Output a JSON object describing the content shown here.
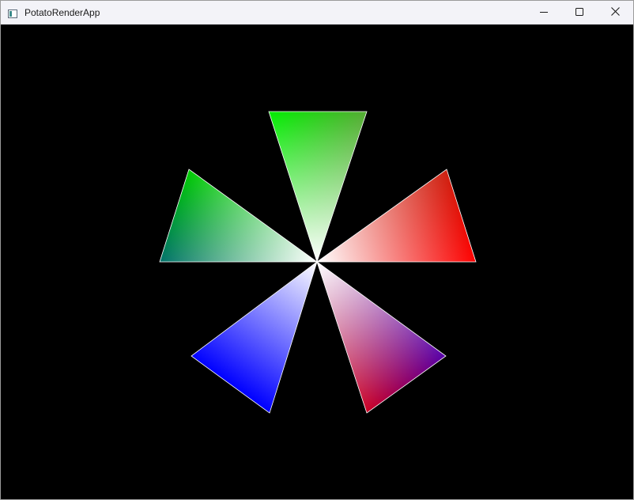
{
  "window": {
    "title": "PotatoRenderApp",
    "icons": {
      "app": "app-window-icon",
      "minimize": "minimize-icon",
      "maximize": "maximize-icon",
      "close": "close-icon"
    }
  },
  "canvas": {
    "background": "#000000",
    "outline_color": "#ffffff",
    "center_color": "#ffffff",
    "triangles": [
      {
        "name": "triangle-top",
        "outer_colors": [
          "#00ee00",
          "#55aa33"
        ]
      },
      {
        "name": "triangle-upper-left",
        "outer_colors": [
          "#00cc00",
          "#00706a"
        ]
      },
      {
        "name": "triangle-upper-right",
        "outer_colors": [
          "#cc2211",
          "#ff0000"
        ]
      },
      {
        "name": "triangle-lower-left",
        "outer_colors": [
          "#0000ff",
          "#0000ff"
        ]
      },
      {
        "name": "triangle-lower-right",
        "outer_colors": [
          "#5500aa",
          "#cc0022"
        ]
      }
    ]
  }
}
